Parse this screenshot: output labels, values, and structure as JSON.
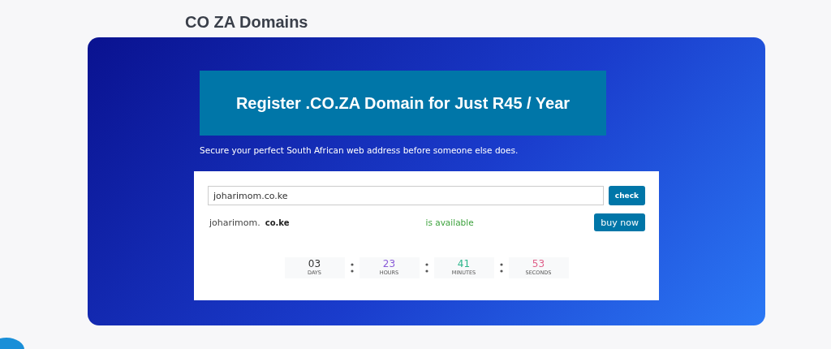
{
  "page_title": "CO ZA Domains",
  "banner": {
    "title": "Register .CO.ZA Domain for Just R45 / Year",
    "subtitle": "Secure your perfect South African web address before someone else does."
  },
  "search": {
    "value": "joharimom.co.ke",
    "button": "check"
  },
  "result": {
    "name": "joharimom.",
    "extension": "co.ke",
    "status": "is available",
    "button": "buy now"
  },
  "countdown": [
    {
      "value": "03",
      "label": "DAYS",
      "color": "#333333"
    },
    {
      "value": "23",
      "label": "HOURS",
      "color": "#8a5cd8"
    },
    {
      "value": "41",
      "label": "MINUTES",
      "color": "#2bb58a"
    },
    {
      "value": "53",
      "label": "SECONDS",
      "color": "#e0608a"
    }
  ]
}
